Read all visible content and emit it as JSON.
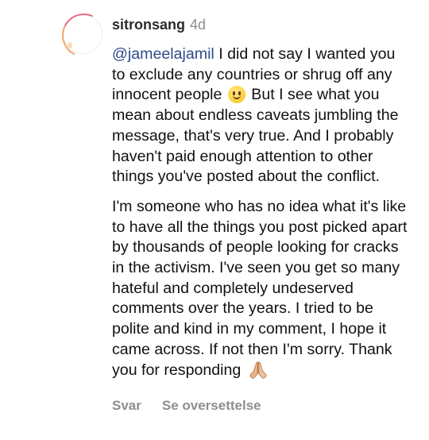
{
  "comment": {
    "username": "sitronsang",
    "time": "4d",
    "mention": "@jameelajamil",
    "para1_before_emoji": "I did not say I wanted you to exclude any countries or shrug off any innocent people",
    "para1_after_emoji": "But I see what you mean about endless caveats jumbling the message, that's very true. And I probably haven't paid enough attention to other things you've posted about the conflict.",
    "para2": "I'm someone who has no idea what it's like to have all the things you post picked apart by thousands of people looking for cracks in the activism. I've seen you get so many hateful and completely undeserved comments over the years. I tried to be polite and kind in my comment, I hope it came across. If not then I'm sorry. Thank you for responding",
    "emoji_smile": "slightly-smiling-face-emoji",
    "emoji_hands": "folded-hands-emoji"
  },
  "actions": {
    "reply": "Svar",
    "translate": "Se oversettelse"
  },
  "colors": {
    "mention": "#2f4a8a",
    "muted": "#8e8e8e",
    "text": "#111111"
  }
}
